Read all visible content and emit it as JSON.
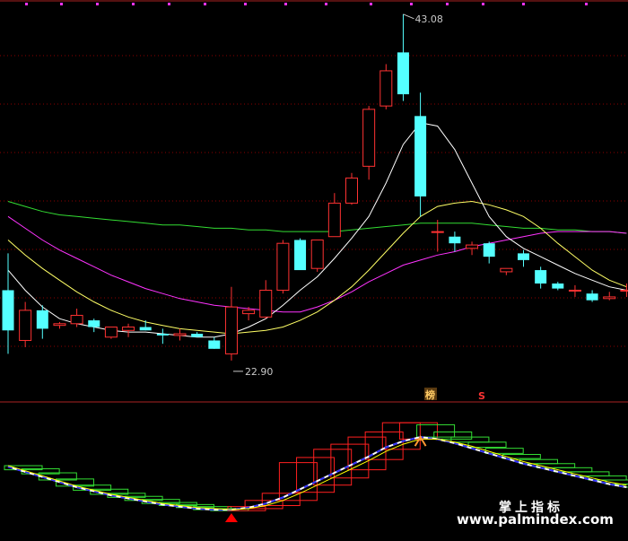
{
  "chart_data": [
    {
      "type": "candlestick",
      "price_range": [
        21.0,
        43.5
      ],
      "labels": {
        "high_label": "43.08",
        "low_label": "22.90"
      },
      "marker_tags": {
        "tag_a": "榜",
        "tag_b": "S"
      },
      "colors": {
        "up": "#ff3232",
        "down": "#54ffff",
        "ma_fast": "#ffffff",
        "ma_mid": "#ffff66",
        "ma_slow": "#ff33ff",
        "ma_long": "#33dd33",
        "grid": "#8b0000",
        "top_markers": "#ff33ff"
      },
      "candles": [
        {
          "o": 26.6,
          "h": 28.8,
          "l": 22.8,
          "c": 24.2
        },
        {
          "o": 23.6,
          "h": 25.9,
          "l": 23.2,
          "c": 25.4
        },
        {
          "o": 25.4,
          "h": 25.7,
          "l": 23.7,
          "c": 24.3
        },
        {
          "o": 24.5,
          "h": 24.7,
          "l": 24.3,
          "c": 24.6
        },
        {
          "o": 24.6,
          "h": 25.5,
          "l": 24.4,
          "c": 25.1
        },
        {
          "o": 24.8,
          "h": 24.9,
          "l": 24.1,
          "c": 24.4
        },
        {
          "o": 23.8,
          "h": 24.4,
          "l": 23.7,
          "c": 24.4
        },
        {
          "o": 24.2,
          "h": 24.6,
          "l": 23.8,
          "c": 24.4
        },
        {
          "o": 24.4,
          "h": 24.8,
          "l": 24.2,
          "c": 24.2
        },
        {
          "o": 24.0,
          "h": 24.3,
          "l": 23.4,
          "c": 23.9
        },
        {
          "o": 23.9,
          "h": 24.3,
          "l": 23.6,
          "c": 24.0
        },
        {
          "o": 24.0,
          "h": 24.1,
          "l": 23.8,
          "c": 23.8
        },
        {
          "o": 23.6,
          "h": 23.8,
          "l": 23.1,
          "c": 23.1
        },
        {
          "o": 22.8,
          "h": 26.8,
          "l": 22.4,
          "c": 25.6
        },
        {
          "o": 25.2,
          "h": 25.6,
          "l": 24.8,
          "c": 25.4
        },
        {
          "o": 25.0,
          "h": 27.2,
          "l": 24.9,
          "c": 26.6
        },
        {
          "o": 26.6,
          "h": 29.6,
          "l": 26.4,
          "c": 29.4
        },
        {
          "o": 29.6,
          "h": 29.7,
          "l": 28.0,
          "c": 27.8
        },
        {
          "o": 27.9,
          "h": 29.5,
          "l": 27.7,
          "c": 29.6
        },
        {
          "o": 29.8,
          "h": 32.4,
          "l": 29.8,
          "c": 31.8
        },
        {
          "o": 31.8,
          "h": 33.6,
          "l": 31.7,
          "c": 33.3
        },
        {
          "o": 34.0,
          "h": 37.6,
          "l": 33.2,
          "c": 37.4
        },
        {
          "o": 37.6,
          "h": 40.1,
          "l": 37.4,
          "c": 39.7
        },
        {
          "o": 40.8,
          "h": 43.08,
          "l": 37.9,
          "c": 38.3
        },
        {
          "o": 37.0,
          "h": 38.4,
          "l": 31.0,
          "c": 32.2
        },
        {
          "o": 30.1,
          "h": 30.8,
          "l": 28.9,
          "c": 30.1
        },
        {
          "o": 29.8,
          "h": 30.1,
          "l": 28.9,
          "c": 29.4
        },
        {
          "o": 29.1,
          "h": 29.5,
          "l": 28.7,
          "c": 29.3
        },
        {
          "o": 29.4,
          "h": 29.5,
          "l": 28.2,
          "c": 28.6
        },
        {
          "o": 27.7,
          "h": 27.9,
          "l": 27.5,
          "c": 27.9
        },
        {
          "o": 28.8,
          "h": 29.0,
          "l": 28.0,
          "c": 28.4
        },
        {
          "o": 27.8,
          "h": 28.0,
          "l": 26.7,
          "c": 27.0
        },
        {
          "o": 27.0,
          "h": 27.1,
          "l": 26.6,
          "c": 26.7
        },
        {
          "o": 26.6,
          "h": 26.9,
          "l": 26.2,
          "c": 26.6
        },
        {
          "o": 26.4,
          "h": 26.6,
          "l": 25.9,
          "c": 26.0
        },
        {
          "o": 26.1,
          "h": 26.5,
          "l": 26.0,
          "c": 26.2
        },
        {
          "o": 26.6,
          "h": 27.0,
          "l": 26.2,
          "c": 26.6
        }
      ],
      "ma_fast": [
        27.8,
        26.6,
        25.6,
        24.9,
        24.6,
        24.4,
        24.2,
        24.1,
        24.1,
        24.0,
        23.9,
        23.8,
        23.8,
        24.0,
        24.4,
        24.9,
        25.7,
        26.6,
        27.4,
        28.5,
        29.7,
        31.0,
        33.0,
        35.3,
        36.6,
        36.4,
        35.0,
        33.0,
        31.0,
        29.8,
        29.1,
        28.6,
        28.1,
        27.6,
        27.2,
        26.8,
        26.6
      ],
      "ma_mid": [
        29.6,
        28.7,
        27.9,
        27.2,
        26.5,
        25.9,
        25.4,
        25.0,
        24.7,
        24.5,
        24.3,
        24.2,
        24.1,
        24.0,
        24.1,
        24.2,
        24.4,
        24.8,
        25.3,
        26.0,
        26.8,
        27.8,
        28.9,
        30.0,
        31.0,
        31.6,
        31.8,
        31.9,
        31.7,
        31.4,
        31.0,
        30.3,
        29.4,
        28.6,
        27.8,
        27.2,
        26.8
      ],
      "ma_slow": [
        31.0,
        30.3,
        29.6,
        29.0,
        28.5,
        28.0,
        27.5,
        27.1,
        26.7,
        26.4,
        26.1,
        25.9,
        25.7,
        25.6,
        25.5,
        25.4,
        25.3,
        25.3,
        25.6,
        26.0,
        26.5,
        27.1,
        27.6,
        28.1,
        28.4,
        28.7,
        28.9,
        29.2,
        29.4,
        29.6,
        29.8,
        30.0,
        30.1,
        30.1,
        30.1,
        30.1,
        30.0
      ],
      "ma_long": [
        31.9,
        31.6,
        31.3,
        31.1,
        31.0,
        30.9,
        30.8,
        30.7,
        30.6,
        30.5,
        30.5,
        30.4,
        30.3,
        30.3,
        30.2,
        30.2,
        30.1,
        30.1,
        30.1,
        30.1,
        30.2,
        30.3,
        30.4,
        30.5,
        30.6,
        30.6,
        30.6,
        30.6,
        30.5,
        30.4,
        30.3,
        30.3,
        30.2,
        30.2,
        30.1,
        30.1,
        30.0
      ]
    },
    {
      "type": "indicator",
      "value_range": [
        0,
        100
      ],
      "colors": {
        "rising": "#ff2020",
        "falling": "#33dd33",
        "line_main": "#ffffff",
        "line_dash": "#3333ff",
        "line_signal": "#ffff00",
        "buy_marker": "#ff0000",
        "sell_marker": "#ff9933"
      },
      "boxes": [
        {
          "lo": 60,
          "hi": 64
        },
        {
          "lo": 56,
          "hi": 61
        },
        {
          "lo": 50,
          "hi": 57
        },
        {
          "lo": 44,
          "hi": 51
        },
        {
          "lo": 40,
          "hi": 45
        },
        {
          "lo": 36,
          "hi": 41
        },
        {
          "lo": 33,
          "hi": 37
        },
        {
          "lo": 30,
          "hi": 34
        },
        {
          "lo": 27,
          "hi": 31
        },
        {
          "lo": 25,
          "hi": 28
        },
        {
          "lo": 23,
          "hi": 26
        },
        {
          "lo": 21,
          "hi": 24
        },
        {
          "lo": 20,
          "hi": 22
        },
        {
          "lo": 20,
          "hi": 24
        },
        {
          "lo": 22,
          "hi": 30
        },
        {
          "lo": 25,
          "hi": 37
        },
        {
          "lo": 30,
          "hi": 67
        },
        {
          "lo": 38,
          "hi": 72
        },
        {
          "lo": 45,
          "hi": 80
        },
        {
          "lo": 52,
          "hi": 85
        },
        {
          "lo": 60,
          "hi": 92
        },
        {
          "lo": 70,
          "hi": 97
        },
        {
          "lo": 80,
          "hi": 106
        },
        {
          "lo": 90,
          "hi": 106
        },
        {
          "lo": 92,
          "hi": 104
        },
        {
          "lo": 90,
          "hi": 97
        },
        {
          "lo": 87,
          "hi": 92
        },
        {
          "lo": 82,
          "hi": 87
        },
        {
          "lo": 76,
          "hi": 81
        },
        {
          "lo": 71,
          "hi": 75
        },
        {
          "lo": 66,
          "hi": 70
        },
        {
          "lo": 62,
          "hi": 66
        },
        {
          "lo": 58,
          "hi": 62
        },
        {
          "lo": 54,
          "hi": 58
        },
        {
          "lo": 50,
          "hi": 54
        },
        {
          "lo": 46,
          "hi": 50
        },
        {
          "lo": 43,
          "hi": 46
        }
      ],
      "line_main": [
        63,
        58,
        53,
        48,
        43,
        39,
        35,
        32,
        29,
        26,
        24,
        22,
        21,
        21,
        23,
        27,
        33,
        41,
        49,
        57,
        65,
        73,
        82,
        88,
        92,
        90,
        86,
        81,
        76,
        71,
        66,
        62,
        58,
        54,
        50,
        46,
        43
      ],
      "line_signal": [
        64,
        59,
        54,
        49,
        44,
        40,
        36,
        33,
        30,
        27,
        25,
        23,
        22,
        21,
        22,
        25,
        30,
        37,
        45,
        53,
        61,
        69,
        78,
        85,
        90,
        90,
        87,
        83,
        78,
        73,
        68,
        64,
        60,
        56,
        52,
        48,
        45
      ],
      "buy_index": 13,
      "sell_index": 24
    }
  ],
  "watermark": {
    "cn": "掌上指标",
    "url": "www.palmindex.com"
  }
}
